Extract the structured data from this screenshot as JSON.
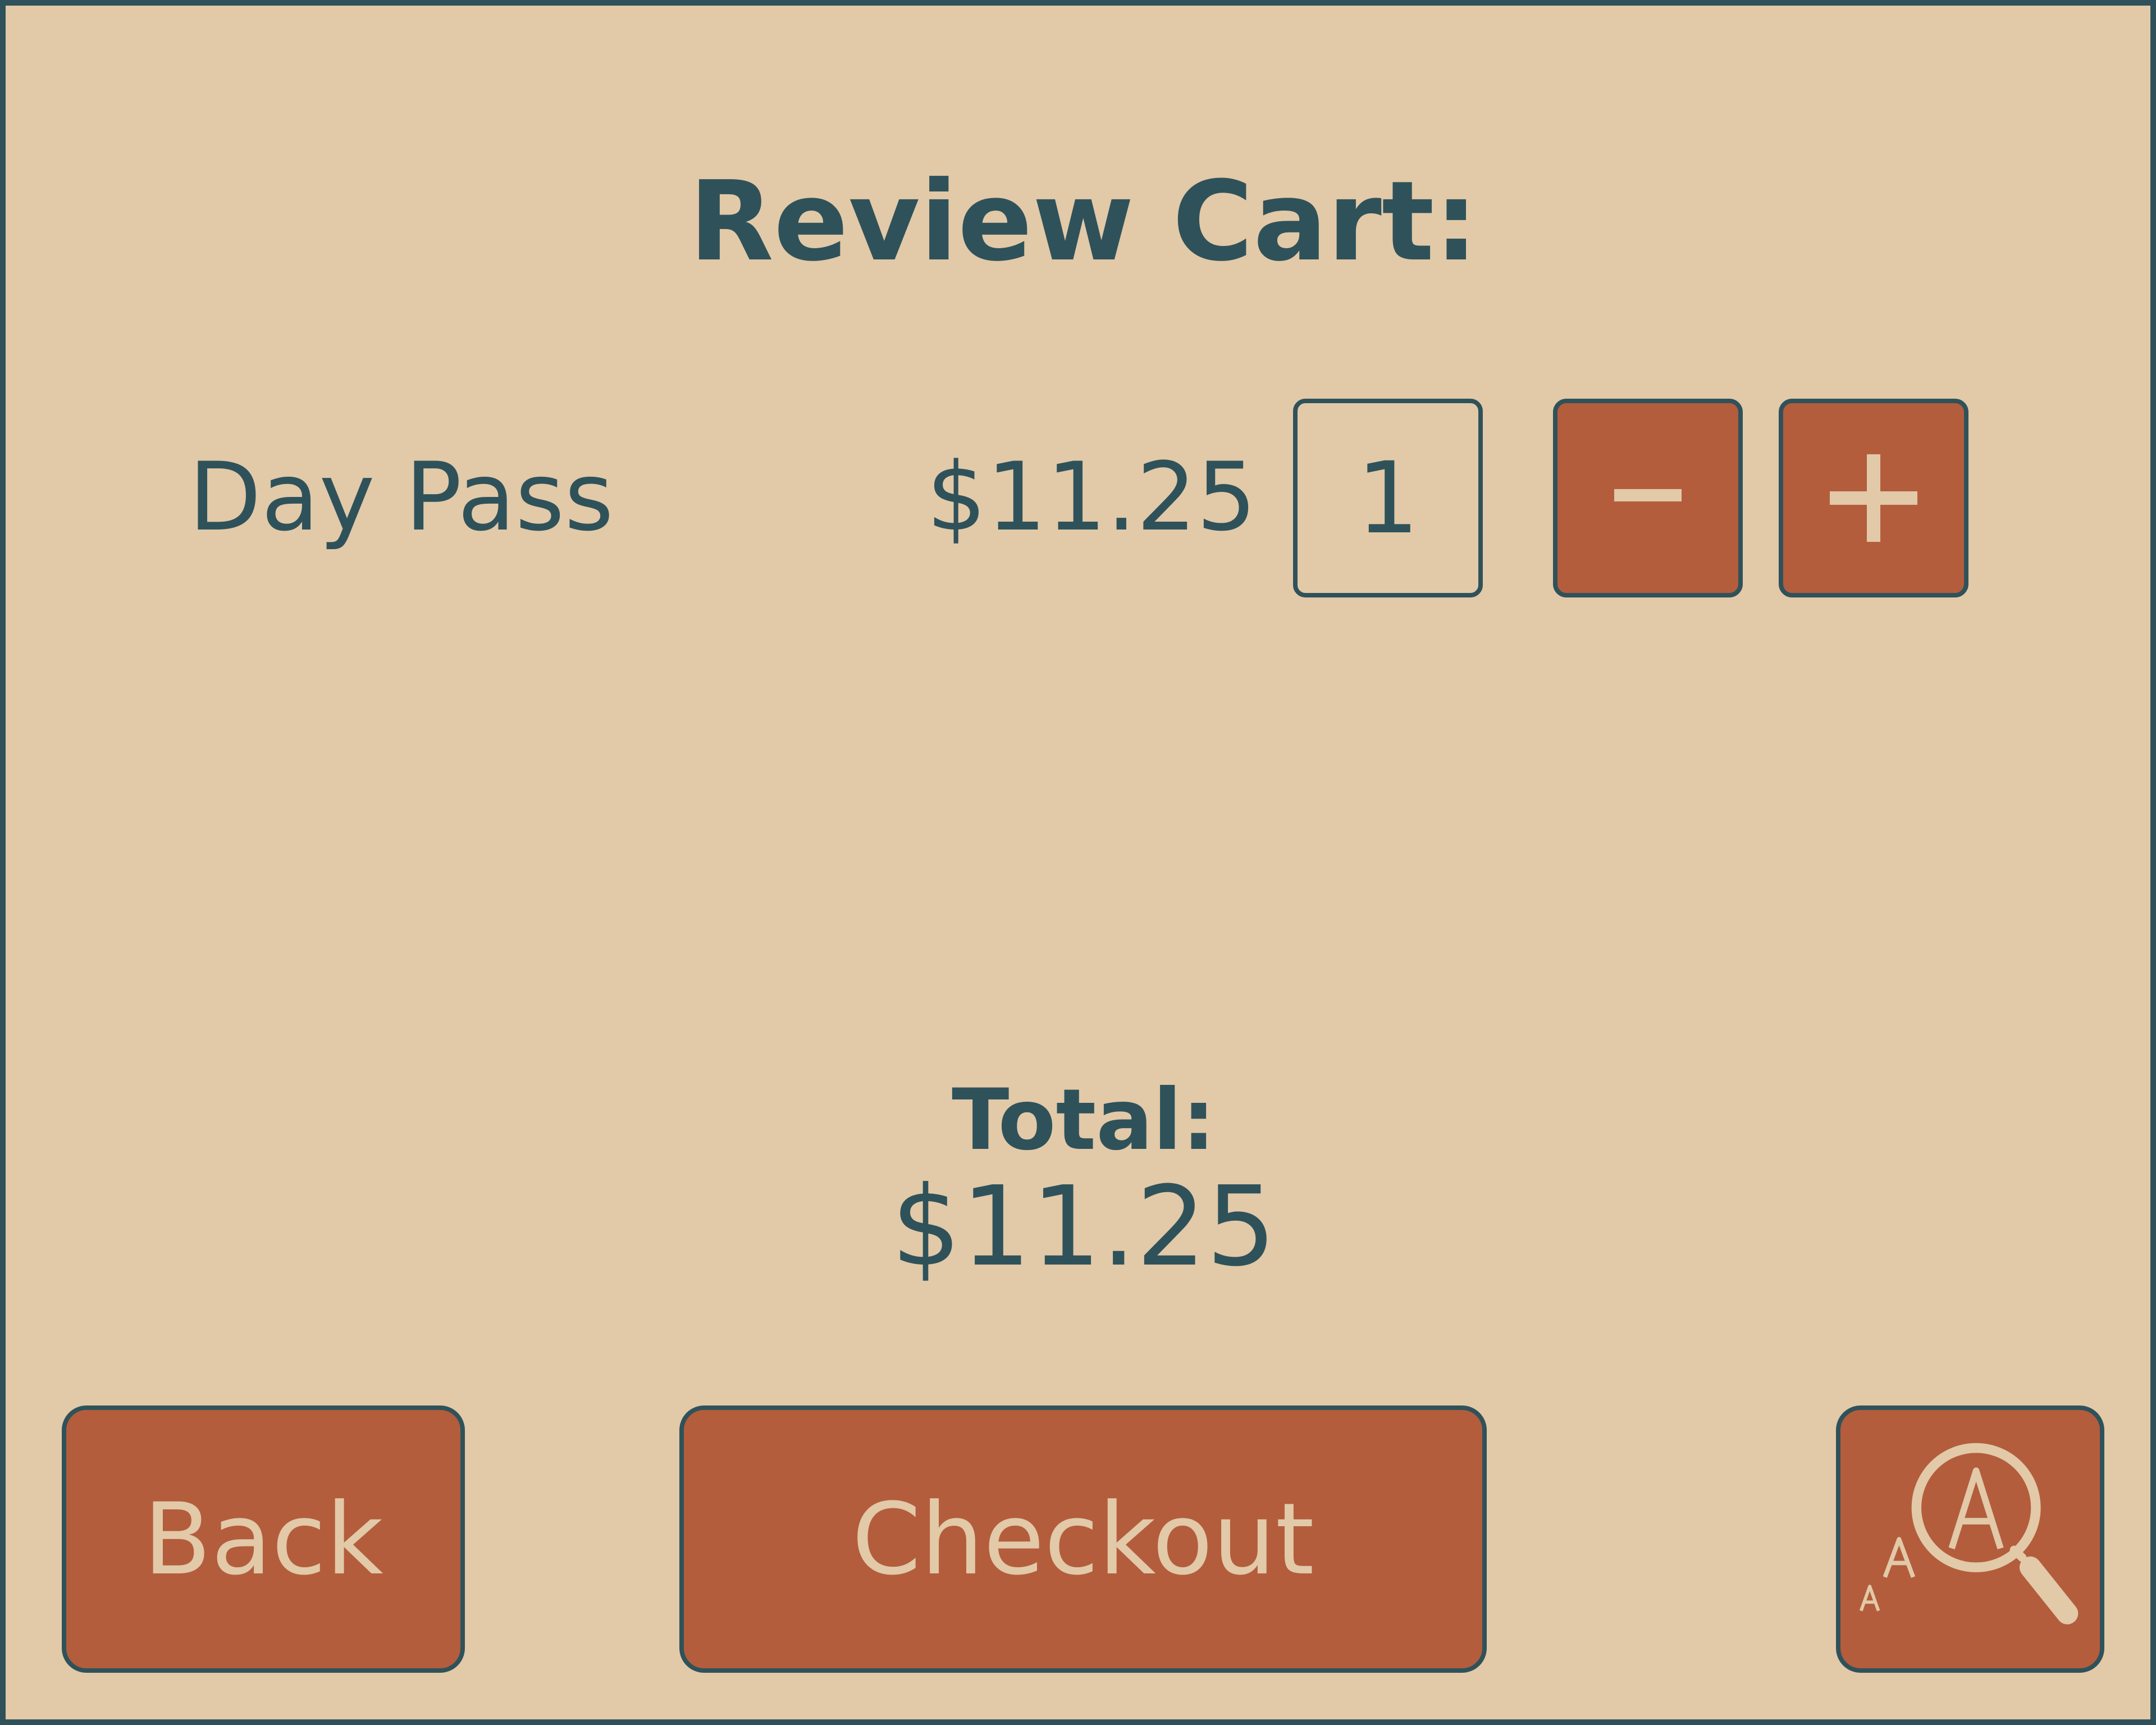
{
  "title": "Review Cart:",
  "cart": {
    "items": [
      {
        "name": "Day Pass",
        "price": "$11.25",
        "quantity": "1"
      }
    ]
  },
  "stepper": {
    "minus_icon": "minus-icon",
    "plus_icon": "plus-icon"
  },
  "total": {
    "label": "Total:",
    "value": "$11.25"
  },
  "buttons": {
    "back": "Back",
    "checkout": "Checkout",
    "text_size_icon": "text-size-magnifier-icon"
  },
  "colors": {
    "background": "#E2C9A8",
    "text": "#2F525A",
    "button": "#B35D3D",
    "button_text": "#E2C9A8"
  }
}
